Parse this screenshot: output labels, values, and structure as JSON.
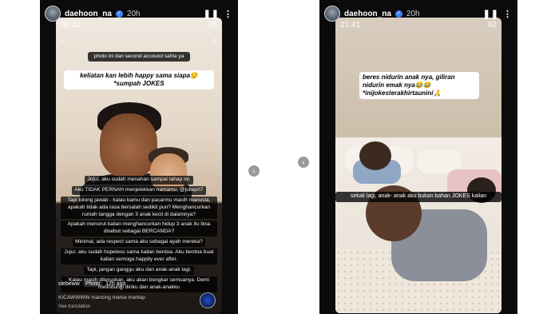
{
  "left_story": {
    "username": "daehoon_na",
    "age": "20h",
    "status_time": "08:42",
    "status_right": "95",
    "photo_note": "photo ini dari second accound safrie ya",
    "highlight_caption": "keliatan kan lebih happy sama siapa😏 *sumpah JOKES",
    "text_lines": [
      "Jujur, aku sudah menahan sampai tahap ini.",
      "Aku TIDAK PERNAH menjelekkan namamu, @juliaprt7",
      "Tapi tolong jawab - kalau kamu dan pacarmu masih manusia, apakah tidak ada rasa bersalah sedikit pun? Menghancurkan rumah tangga dengan 3 anak kecil di dalamnya?",
      "Apakah menurut kalian menghancurkan hidup 3 anak itu bisa disebut sebagai BERCANDA?",
      "Minimal, ada respect sama aku sebagai ayah mereka?",
      "Jujur, aku sudah hopeless sama kalian berdua. Aku berdoa buat kalian semoga happily ever after.",
      "Tapi, jangan ganggu aku dan anak-anak lagi.",
      "Kalau masih diteruskan, aku akan bongkar semuanya. Demi melindungi diriku dan anak-anakku"
    ],
    "footer_user": "slebeww",
    "footer_badge": "Photo",
    "footer_age": "12h ago",
    "footer_comment": "KICAWWWW mancing mania mantap",
    "footer_translate": "See translation"
  },
  "right_story": {
    "username": "daehoon_na",
    "age": "20h",
    "status_time": "21:41",
    "status_right": "82",
    "top_caption": "beres nidurin anak nya, giliran nidurin emak nya😂😂 *inijokesterakhirtaunini🙏",
    "bottom_caption": "sekali lagi, anak- anak aku bukan bahan JOKES kalian"
  },
  "icons": {
    "pause": "pause-icon",
    "more": "more-icon",
    "next": "next-arrow-icon",
    "prev": "prev-arrow-icon"
  },
  "nav": {
    "pause_glyph": "❚❚",
    "more_glyph": "⋮",
    "next_glyph": "›",
    "prev_glyph": "‹",
    "verified_glyph": "✓",
    "back_glyph": "‹",
    "search_glyph": "⌕"
  }
}
